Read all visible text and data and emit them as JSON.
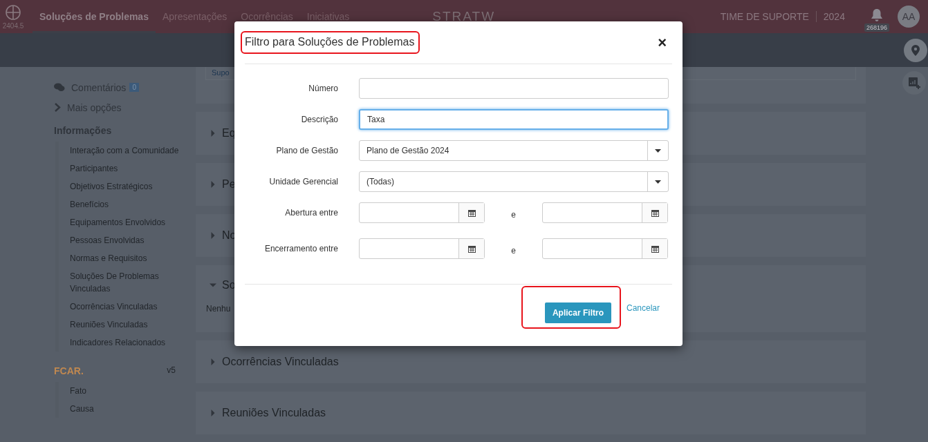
{
  "navbar": {
    "version": "2404.5",
    "tabs": [
      {
        "label": "Soluções de Problemas",
        "selected": true
      },
      {
        "label": "Apresentações",
        "selected": false
      },
      {
        "label": "Ocorrências",
        "selected": false
      },
      {
        "label": "Iniciativas",
        "selected": false
      }
    ],
    "logo_text": "STRATW",
    "team": "TIME DE SUPORTE",
    "year": "2024",
    "notifications": "268196",
    "avatar": "AA"
  },
  "sidebar": {
    "comments": {
      "label": "Comentários",
      "count": "0"
    },
    "more": "Mais opções",
    "info_title": "Informações",
    "info_items": [
      "Interação com a Comunidade",
      "Participantes",
      "Objetivos Estratégicos",
      "Benefícios",
      "Equipamentos Envolvidos",
      "Pessoas Envolvidas",
      "Normas e Requisitos",
      "Soluções De Problemas Vinculadas",
      "Ocorrências Vinculadas",
      "Reuniões Vinculadas",
      "Indicadores Relacionados"
    ],
    "fcar_title": "FCAR.",
    "fcar_version": "v5",
    "fcar_items": [
      "Fato",
      "Causa"
    ]
  },
  "main": {
    "top_select": "Supo",
    "sections": [
      {
        "title": "Eq",
        "expanded": false
      },
      {
        "title": "Pe",
        "expanded": false
      },
      {
        "title": "No",
        "expanded": false
      },
      {
        "title": "So",
        "expanded": true,
        "note": "Nenhu"
      },
      {
        "title": "Ocorrências Vinculadas",
        "expanded": false
      },
      {
        "title": "Reuniões Vinculadas",
        "expanded": false
      }
    ]
  },
  "modal": {
    "title": "Filtro para Soluções de Problemas",
    "close": "×",
    "fields": [
      {
        "kind": "text",
        "label": "Número",
        "focused": false
      },
      {
        "kind": "text",
        "label": "Descrição",
        "value": "Taxa",
        "focused": true
      },
      {
        "kind": "select",
        "label": "Plano de Gestão",
        "value": "Plano de Gestão 2024"
      },
      {
        "kind": "select",
        "label": "Unidade Gerencial",
        "value": "(Todas)"
      },
      {
        "kind": "daterange",
        "label": "Abertura entre",
        "joiner": "e"
      },
      {
        "kind": "daterange",
        "label": "Encerramento entre",
        "joiner": "e"
      }
    ],
    "apply": "Aplicar Filtro",
    "cancel": "Cancelar"
  }
}
